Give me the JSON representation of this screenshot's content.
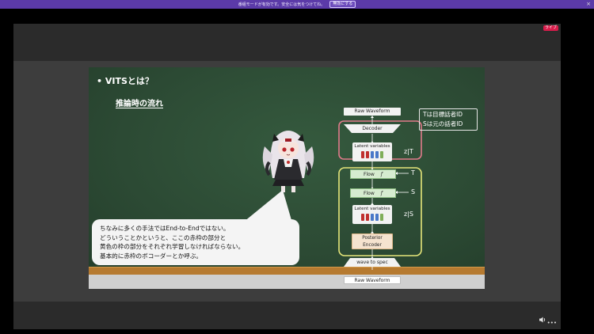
{
  "notification": {
    "message": "番組モードが有効です。安全には気をつけてね。",
    "button_label": "無効にする",
    "close_glyph": "×"
  },
  "player": {
    "live_badge": "ライブ",
    "volume_icon": "speaker-icon",
    "more_glyph": "•••"
  },
  "slide": {
    "title": "• VITSとは？",
    "subtitle": "推論時の流れ",
    "note_lines": [
      "Tは目標話者ID",
      "Sは元の話者ID"
    ],
    "bubble_lines": [
      "ちなみに多くの手法ではEnd-to-Endではない。",
      "どういうことかというと、ここの赤枠の部分と",
      "黄色の枠の部分をそれぞれ学習しなければならない。",
      "基本的に赤枠のボコーダーとか呼ぶ。"
    ],
    "diagram": {
      "raw_waveform_top": "Raw Waveform",
      "decoder": "Decoder",
      "latent_variables_top": "Latent variables",
      "z_given_t": "z|T",
      "flow_top": "Flow",
      "flow_top_symbol": "f",
      "flow_top_cond": "T",
      "flow_bottom": "Flow",
      "flow_bottom_symbol": "f",
      "flow_bottom_cond": "S",
      "latent_variables_bottom": "Latent variables",
      "z_given_s": "z|S",
      "posterior_encoder_line1": "Posterior",
      "posterior_encoder_line2": "Encoder",
      "wave_to_spec": "wave to spec",
      "raw_waveform_bottom": "Raw Waveform"
    }
  },
  "colors": {
    "notification_bar": "#5b3aa8",
    "chalkboard": "#2e4b35",
    "red_frame": "#e07a8a",
    "yellow_frame": "#e6e67a",
    "flow_fill": "#d6ecd0",
    "latent_bar_colors": [
      "#c0302e",
      "#c0302e",
      "#4a78c8",
      "#4a78c8",
      "#7fae5a"
    ]
  }
}
